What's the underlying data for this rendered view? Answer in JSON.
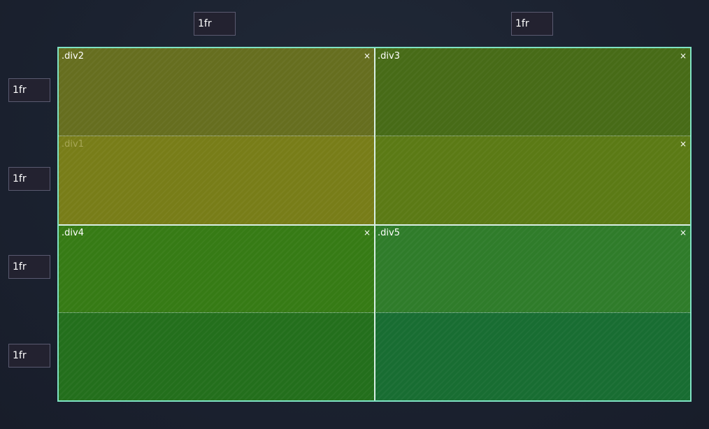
{
  "column_tracks": [
    {
      "value": "1fr"
    },
    {
      "value": "1fr"
    }
  ],
  "row_tracks": [
    {
      "value": "1fr"
    },
    {
      "value": "1fr"
    },
    {
      "value": "1fr"
    },
    {
      "value": "1fr"
    }
  ],
  "areas": {
    "div2": {
      "label": ".div2",
      "close": "×",
      "color": "#666e1f"
    },
    "div3": {
      "label": ".div3",
      "close": "×",
      "color": "#476b17"
    },
    "div1": {
      "label": ".div1",
      "color": "#787d18"
    },
    "div3_lower": {
      "close": "×",
      "color": "#5b7a15"
    },
    "div4": {
      "label": ".div4",
      "close": "×",
      "color": "#367b15"
    },
    "div5": {
      "label": ".div5",
      "close": "×",
      "color": "#2f7c2a"
    },
    "div4_lower": {
      "color": "#236f1c"
    },
    "div5_lower": {
      "color": "#186d32"
    }
  },
  "colors": {
    "grid_border": "#7fe3c4",
    "grid_line": "#d9efe6",
    "background": "#1b2230",
    "input_background": "#232230"
  }
}
